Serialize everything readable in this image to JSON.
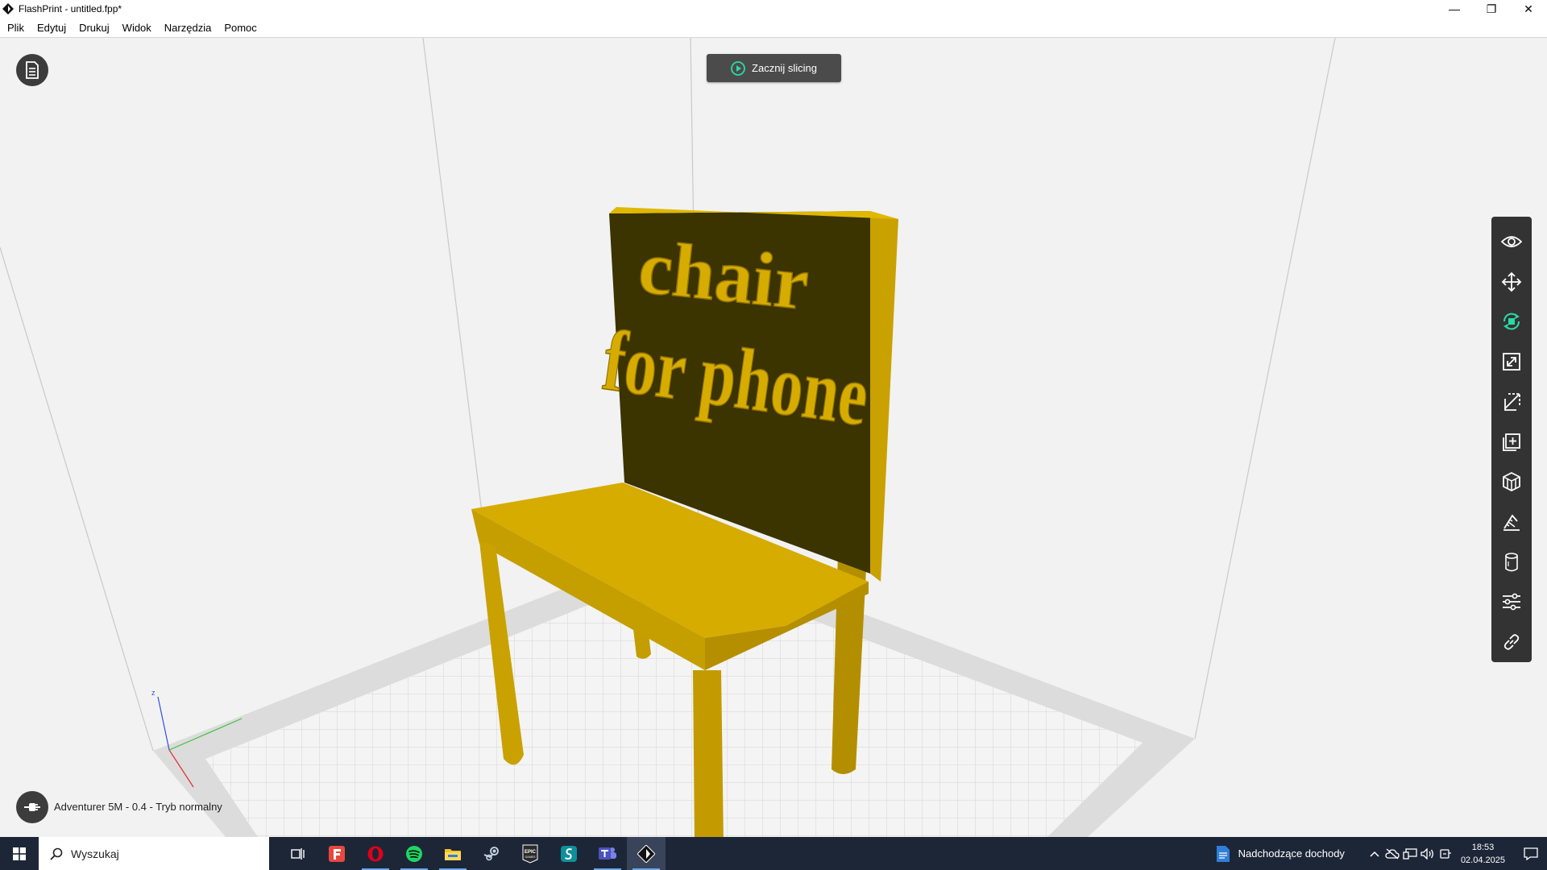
{
  "window": {
    "title": "FlashPrint - untitled.fpp*",
    "minimize": "—",
    "restore": "❐",
    "close": "✕"
  },
  "menu": [
    "Plik",
    "Edytuj",
    "Drukuj",
    "Widok",
    "Narzędzia",
    "Pomoc"
  ],
  "viewport": {
    "slice_button": "Zacznij slicing",
    "model_text_line1": "chair",
    "model_text_line2": "for phone",
    "axis_z": "z",
    "model_color": "#d6ac00",
    "model_dark": "#3b3300",
    "printer_info": "Adventurer 5M - 0.4 - Tryb normalny"
  },
  "toolbar": {
    "icons": [
      "eye-icon",
      "move-icon",
      "rotate-icon",
      "scale-icon",
      "cut-icon",
      "add-icon",
      "supports-icon",
      "measure-icon",
      "cylinder-icon",
      "settings-icon",
      "link-icon"
    ],
    "accent": "#2bd9a5"
  },
  "taskbar": {
    "search_placeholder": "Wyszukaj",
    "news": "Nadchodzące dochody",
    "time": "18:53",
    "date": "02.04.2025",
    "apps": [
      "task-view-icon",
      "flashprint-f-icon",
      "opera-icon",
      "spotify-icon",
      "file-explorer-icon",
      "steam-icon",
      "epic-games-icon",
      "sketch-s-icon",
      "teams-icon",
      "flashprint-icon"
    ]
  }
}
